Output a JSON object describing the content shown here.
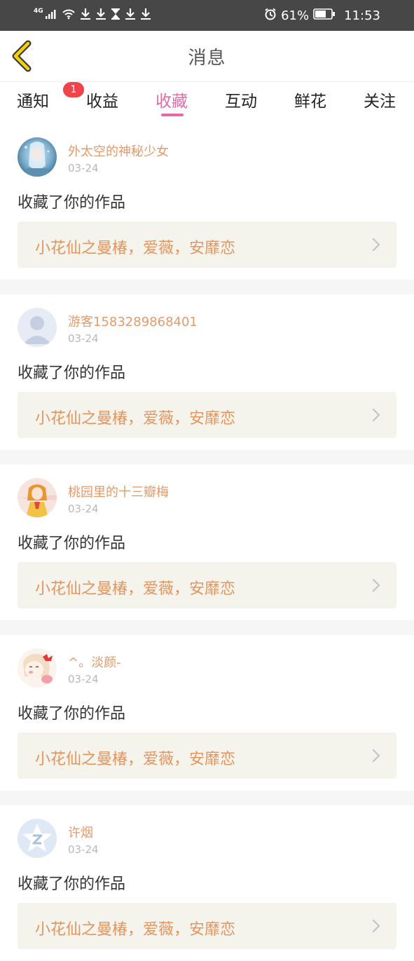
{
  "status_bar": {
    "signal_label": "4G",
    "battery_percent": "61%",
    "time": "11:53"
  },
  "header": {
    "title": "消息"
  },
  "tabs": [
    {
      "label": "通知",
      "badge": "1"
    },
    {
      "label": "收益"
    },
    {
      "label": "收藏",
      "active": true
    },
    {
      "label": "互动"
    },
    {
      "label": "鲜花"
    },
    {
      "label": "关注"
    }
  ],
  "feed": [
    {
      "user": "外太空的神秘少女",
      "date": "03-24",
      "action": "收藏了你的作品",
      "work": "小花仙之曼椿，爱薇，安靡恋"
    },
    {
      "user": "游客1583289868401",
      "date": "03-24",
      "action": "收藏了你的作品",
      "work": "小花仙之曼椿，爱薇，安靡恋"
    },
    {
      "user": "桃园里的十三瓣梅",
      "date": "03-24",
      "action": "收藏了你的作品",
      "work": "小花仙之曼椿，爱薇，安靡恋"
    },
    {
      "user": "^。淡颜-",
      "date": "03-24",
      "action": "收藏了你的作品",
      "work": "小花仙之曼椿，爱薇，安靡恋"
    },
    {
      "user": "许烟",
      "date": "03-24",
      "action": "收藏了你的作品",
      "work": "小花仙之曼椿，爱薇，安靡恋"
    }
  ],
  "colors": {
    "accent": "#e46aa8",
    "username": "#e59a6b",
    "work_title": "#e4955f",
    "badge": "#f0434a",
    "status_bar": "#474747"
  }
}
